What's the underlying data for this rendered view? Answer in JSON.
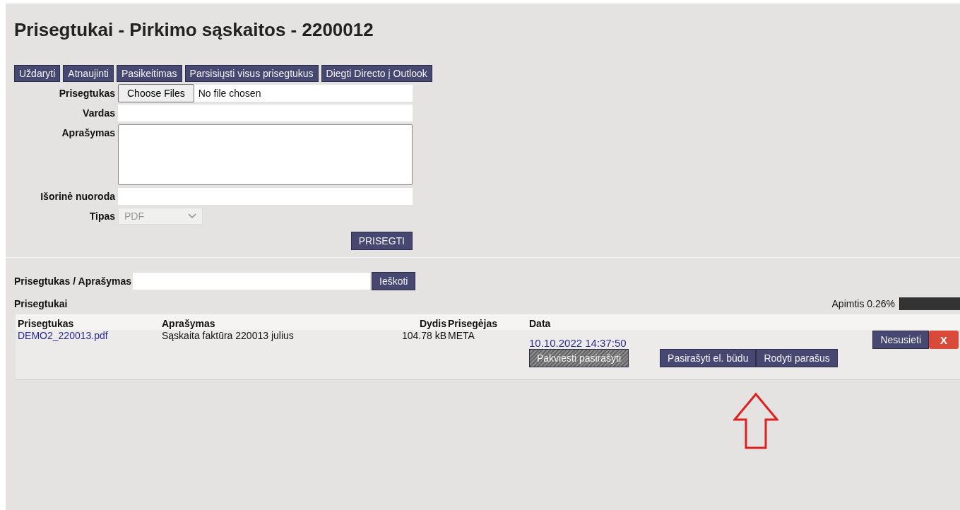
{
  "title": "Prisegtukai - Pirkimo sąskaitos - 2200012",
  "toolbar": [
    "Uždaryti",
    "Atnaujinti",
    "Pasikeitimas",
    "Parsisiųsti visus prisegtukus",
    "Diegti Directo į Outlook"
  ],
  "form": {
    "file_label": "Prisegtukas",
    "file_button": "Choose Files",
    "file_status": "No file chosen",
    "name_label": "Vardas",
    "description_label": "Aprašymas",
    "link_label": "Išorinė nuoroda",
    "type_label": "Tipas",
    "type_value": "PDF",
    "type_disabled": true,
    "submit": "PRISEGTI"
  },
  "search": {
    "label": "Prisegtukas / Aprašymas",
    "button": "Ieškoti"
  },
  "list_title": "Prisegtukai",
  "usage": {
    "label": "Apimtis 0.26%",
    "level": 0.0026
  },
  "table": {
    "columns": [
      "Prisegtukas",
      "Aprašymas",
      "Dydis",
      "Prisegėjas",
      "Data"
    ],
    "rows": [
      {
        "file": "DEMO2_220013.pdf",
        "description": "Sąskaita faktūra 220013 julius",
        "size": "104.78 kB",
        "author": "META",
        "date": "10.10.2022 14:37:50",
        "invite": {
          "label": "Pakviesti pasirašyti",
          "disabled": true
        },
        "sign": "Pasirašyti el. būdu",
        "show": "Rodyti parašus",
        "unlink": "Nesusieti",
        "delete": "X"
      }
    ]
  }
}
